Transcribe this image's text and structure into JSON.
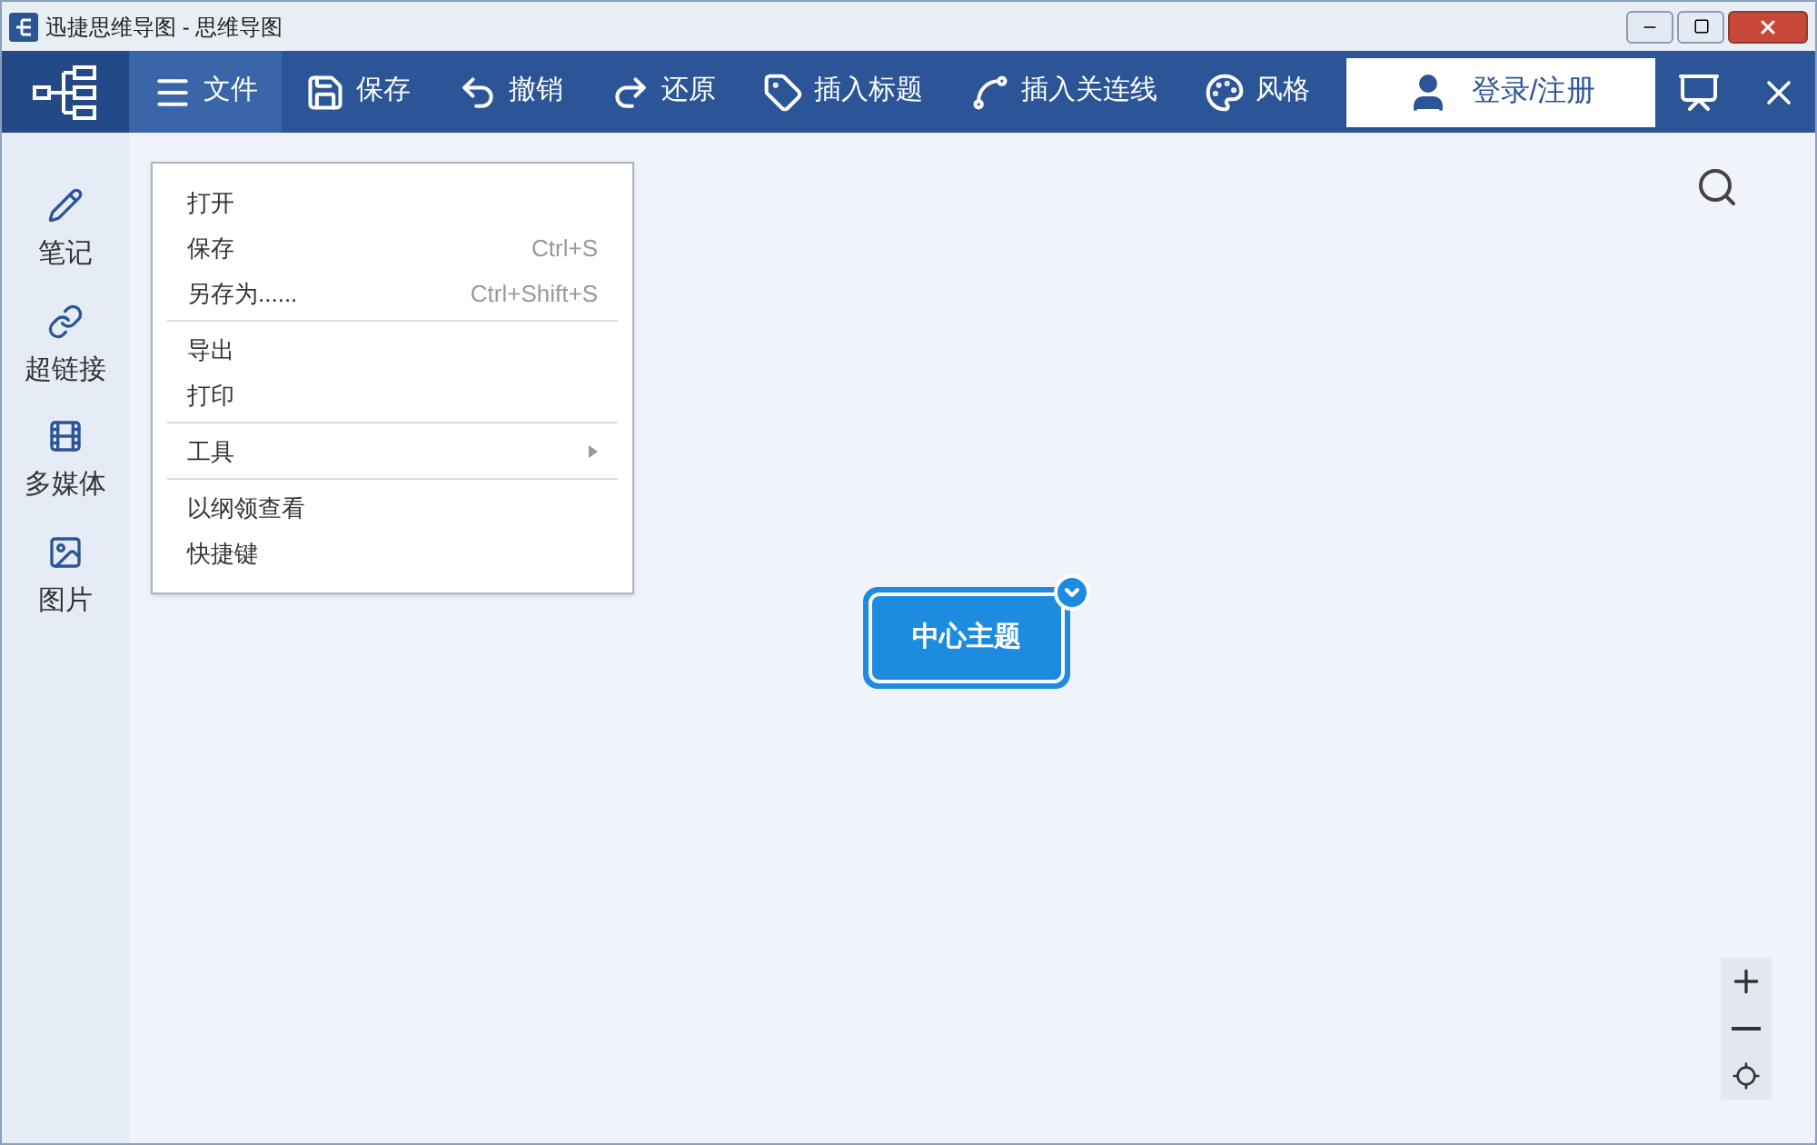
{
  "window": {
    "title": "迅捷思维导图 - 思维导图"
  },
  "toolbar": {
    "items": [
      {
        "label": "文件",
        "selected": true
      },
      {
        "label": "保存",
        "selected": false
      },
      {
        "label": "撤销",
        "selected": false
      },
      {
        "label": "还原",
        "selected": false
      },
      {
        "label": "插入标题",
        "selected": false
      },
      {
        "label": "插入关连线",
        "selected": false
      },
      {
        "label": "风格",
        "selected": false
      }
    ],
    "login": "登录/注册"
  },
  "file_menu": {
    "sections": [
      [
        {
          "label": "打开",
          "submenu": false
        },
        {
          "label": "保存",
          "shortcut": "Ctrl+S",
          "submenu": false
        },
        {
          "label": "另存为......",
          "shortcut": "Ctrl+Shift+S",
          "submenu": false
        }
      ],
      [
        {
          "label": "导出",
          "submenu": false
        },
        {
          "label": "打印",
          "submenu": false
        }
      ],
      [
        {
          "label": "工具",
          "submenu": true
        }
      ],
      [
        {
          "label": "以纲领查看",
          "submenu": false
        },
        {
          "label": "快捷键",
          "submenu": false
        }
      ]
    ]
  },
  "sidebar": {
    "items": [
      {
        "label": "笔记"
      },
      {
        "label": "超链接"
      },
      {
        "label": "多媒体"
      },
      {
        "label": "图片"
      }
    ]
  },
  "canvas": {
    "central_topic": "中心主题"
  }
}
